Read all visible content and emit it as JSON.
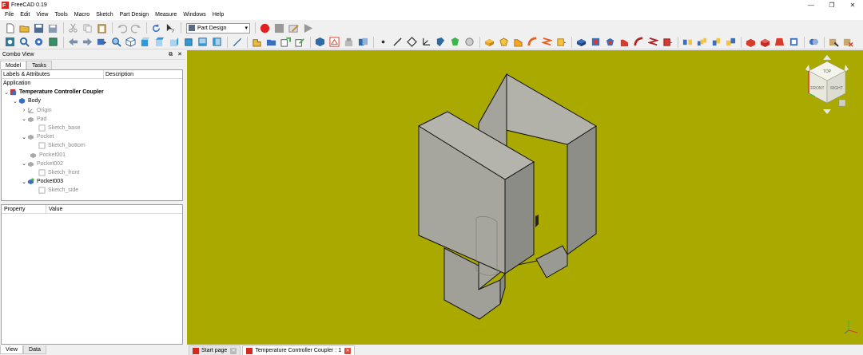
{
  "window": {
    "title": "FreeCAD 0.19",
    "minimize": "—",
    "restore": "❐",
    "close": "✕"
  },
  "menu": [
    "File",
    "Edit",
    "View",
    "Tools",
    "Macro",
    "Sketch",
    "Part Design",
    "Measure",
    "Windows",
    "Help"
  ],
  "toolbar": {
    "workbench": "Part Design"
  },
  "combo_view": {
    "title": "Combo View",
    "float_icon": "⧉",
    "close_icon": "✕",
    "tabs": [
      "Model",
      "Tasks"
    ],
    "tree_columns": [
      "Labels & Attributes",
      "Description"
    ],
    "tree": {
      "application": "Application",
      "document": "Temperature Controller Coupler",
      "body": "Body",
      "origin": "Origin",
      "pad": "Pad",
      "sketch_base": "Sketch_base",
      "pocket": "Pocket",
      "sketch_bottom": "Sketch_bottom",
      "pocket001": "Pocket001",
      "pocket002": "Pocket002",
      "sketch_front": "Sketch_front",
      "pocket003": "Pocket003",
      "sketch_side": "Sketch_side"
    },
    "property_columns": [
      "Property",
      "Value"
    ],
    "bottom_tabs": [
      "View",
      "Data"
    ]
  },
  "nav_cube": {
    "faces": [
      "TOP",
      "FRONT",
      "RIGHT"
    ]
  },
  "doc_tabs": [
    "Start page",
    "Temperature Controller Coupler : 1"
  ],
  "colors": {
    "viewport": "#a9a900",
    "model_face_light": "#b0b0a8",
    "model_face_dark": "#8c8c86",
    "record": "#e02020"
  }
}
